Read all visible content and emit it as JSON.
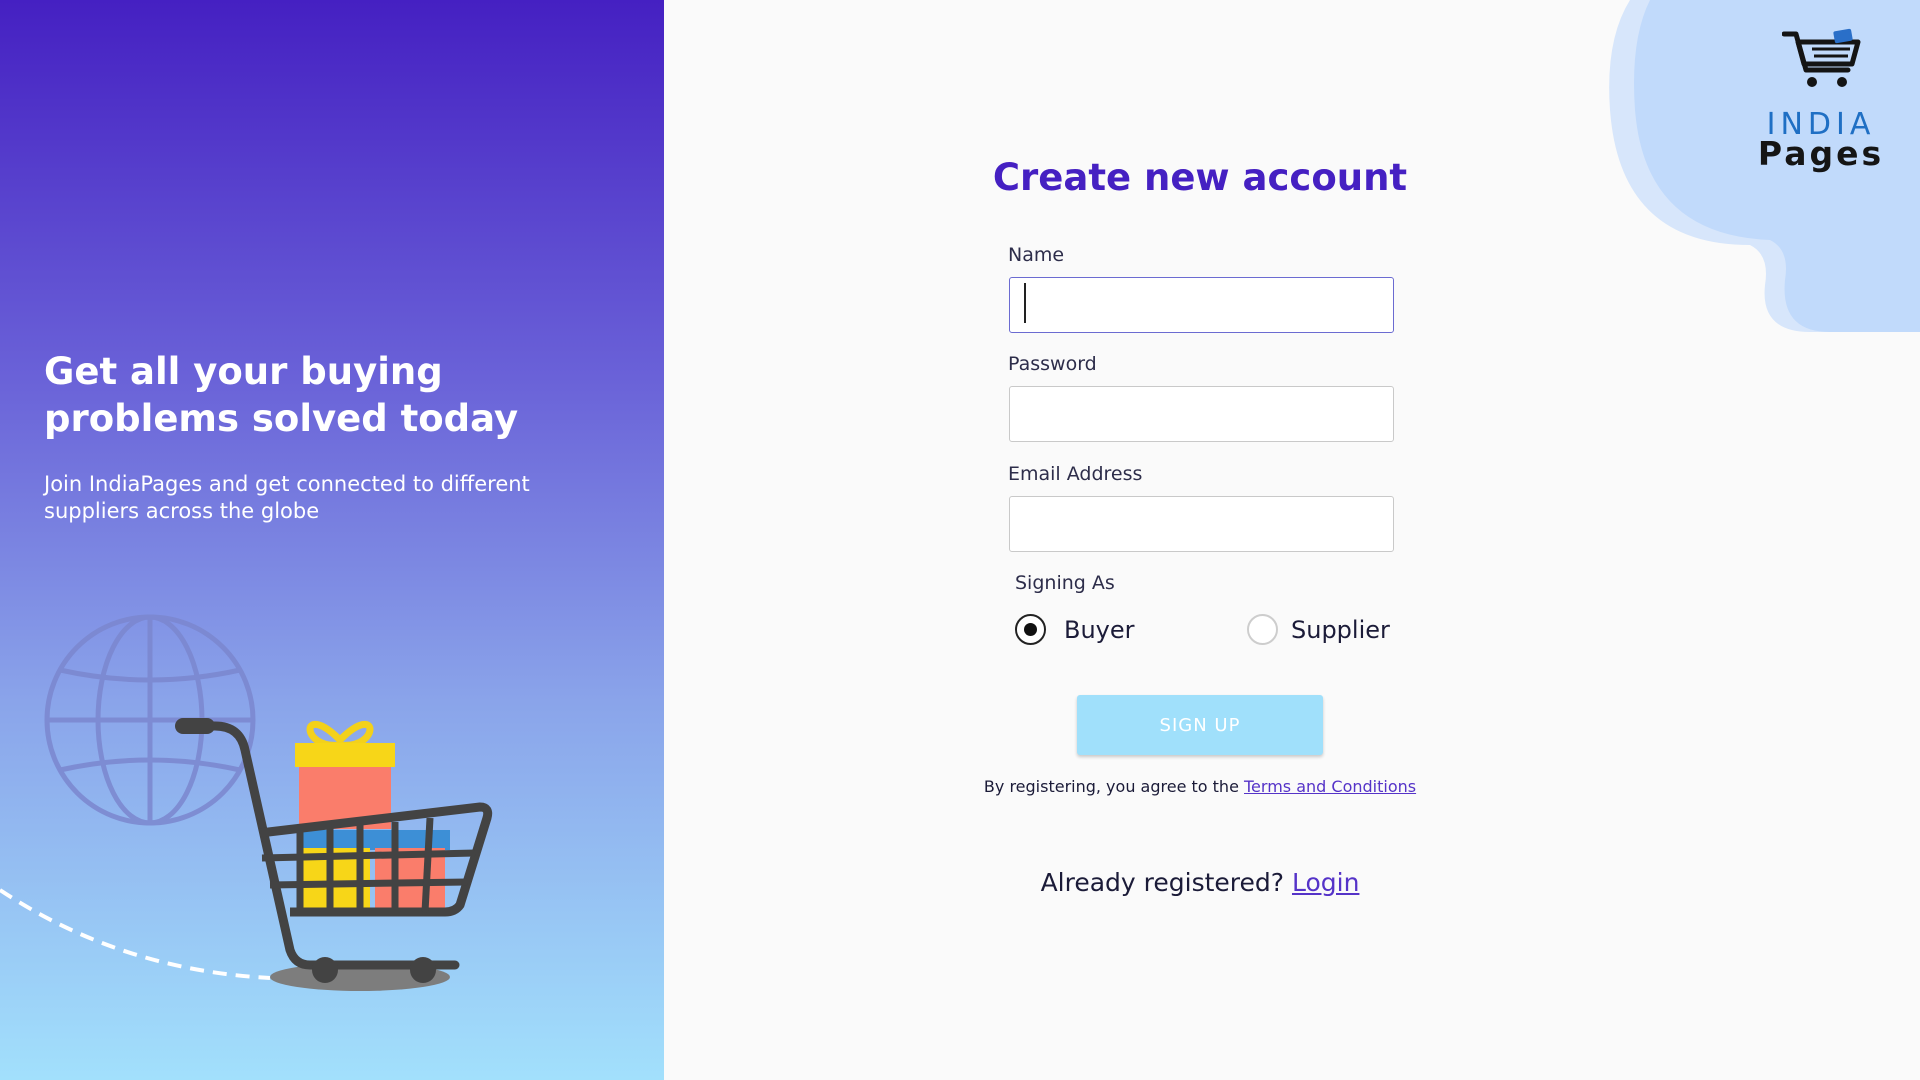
{
  "hero": {
    "title": "Get all your buying problems solved today",
    "subtitle": "Join IndiaPages and get connected to different suppliers across the globe"
  },
  "logo": {
    "line1": "INDIA",
    "line2": "Pages"
  },
  "form": {
    "title": "Create new account",
    "name_label": "Name",
    "name_value": "",
    "password_label": "Password",
    "password_value": "",
    "email_label": "Email Address",
    "email_value": "",
    "signing_as_label": "Signing As",
    "options": [
      {
        "label": "Buyer",
        "selected": true
      },
      {
        "label": "Supplier",
        "selected": false
      }
    ],
    "signup_label": "SIGN UP",
    "terms_prefix": "By registering, you agree to the ",
    "terms_link": "Terms and Conditions",
    "already_text": "Already registered? ",
    "login_link": "Login"
  },
  "colors": {
    "accent": "#4520c2",
    "button": "#a0e0fb",
    "link": "#5533c8"
  },
  "icons": [
    "globe-icon",
    "shopping-cart-icon",
    "gift-icon",
    "logo-cart-icon"
  ]
}
